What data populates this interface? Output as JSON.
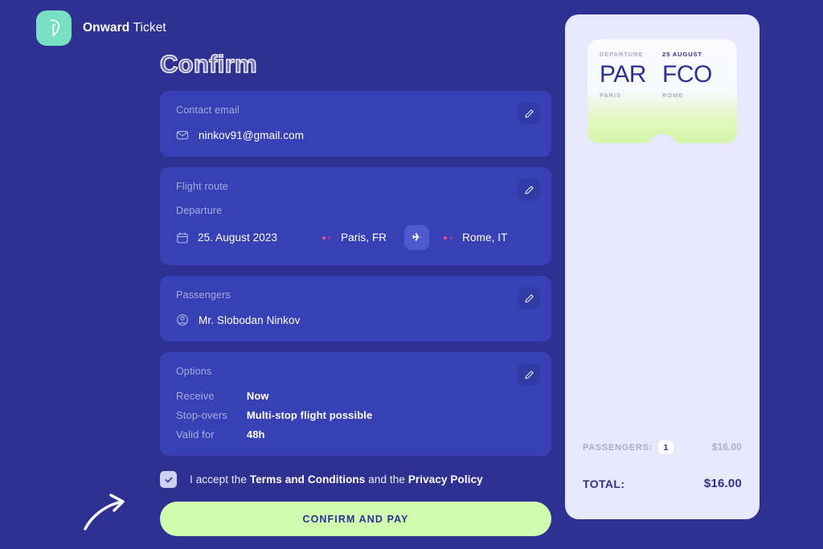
{
  "brand": {
    "name_strong": "Onward",
    "name_light": "Ticket",
    "logo_icon": "onward-ticket-logo-icon",
    "logo_color": "#77dfc2"
  },
  "page": {
    "title": "Confirm",
    "background_color": "#2e3192",
    "card_color": "#3740b5",
    "accent_green": "#cffcae",
    "panel_color": "#e7e8fc"
  },
  "cards": {
    "contact": {
      "title": "Contact email",
      "email": "ninkov91@gmail.com",
      "icon": "envelope-icon",
      "edit_icon": "pencil-icon"
    },
    "route": {
      "title": "Flight route",
      "sub_label": "Departure",
      "date": "25. August 2023",
      "origin": "Paris, FR",
      "destination": "Rome, IT",
      "calendar_icon": "calendar-icon",
      "plane_icon": "airplane-icon",
      "edit_icon": "pencil-icon"
    },
    "passengers": {
      "title": "Passengers",
      "name": "Mr. Slobodan Ninkov",
      "icon": "user-icon",
      "edit_icon": "pencil-icon"
    },
    "options": {
      "title": "Options",
      "edit_icon": "pencil-icon",
      "rows": [
        {
          "key": "Receive",
          "value": "Now"
        },
        {
          "key": "Stop-overs",
          "value": "Multi-stop flight possible"
        },
        {
          "key": "Valid for",
          "value": "48h"
        }
      ]
    }
  },
  "terms": {
    "checked": true,
    "check_icon": "checkmark-icon",
    "prefix": "I accept the ",
    "link1": "Terms and Conditions",
    "middle": " and the ",
    "link2": "Privacy Policy"
  },
  "pay_button": {
    "label": "CONFIRM AND PAY"
  },
  "hint": {
    "arrow_icon": "curved-arrow-icon"
  },
  "ticket": {
    "departure_label": "DEPARTURE",
    "date_label": "25 AUGUST",
    "origin_code": "PAR",
    "destination_code": "FCO",
    "origin_city": "PARIS",
    "destination_city": "ROME"
  },
  "summary": {
    "passengers_label": "PASSENGERS:",
    "passengers_count": "1",
    "passengers_price": "$16.00",
    "total_label": "TOTAL:",
    "total_value": "$16.00"
  }
}
